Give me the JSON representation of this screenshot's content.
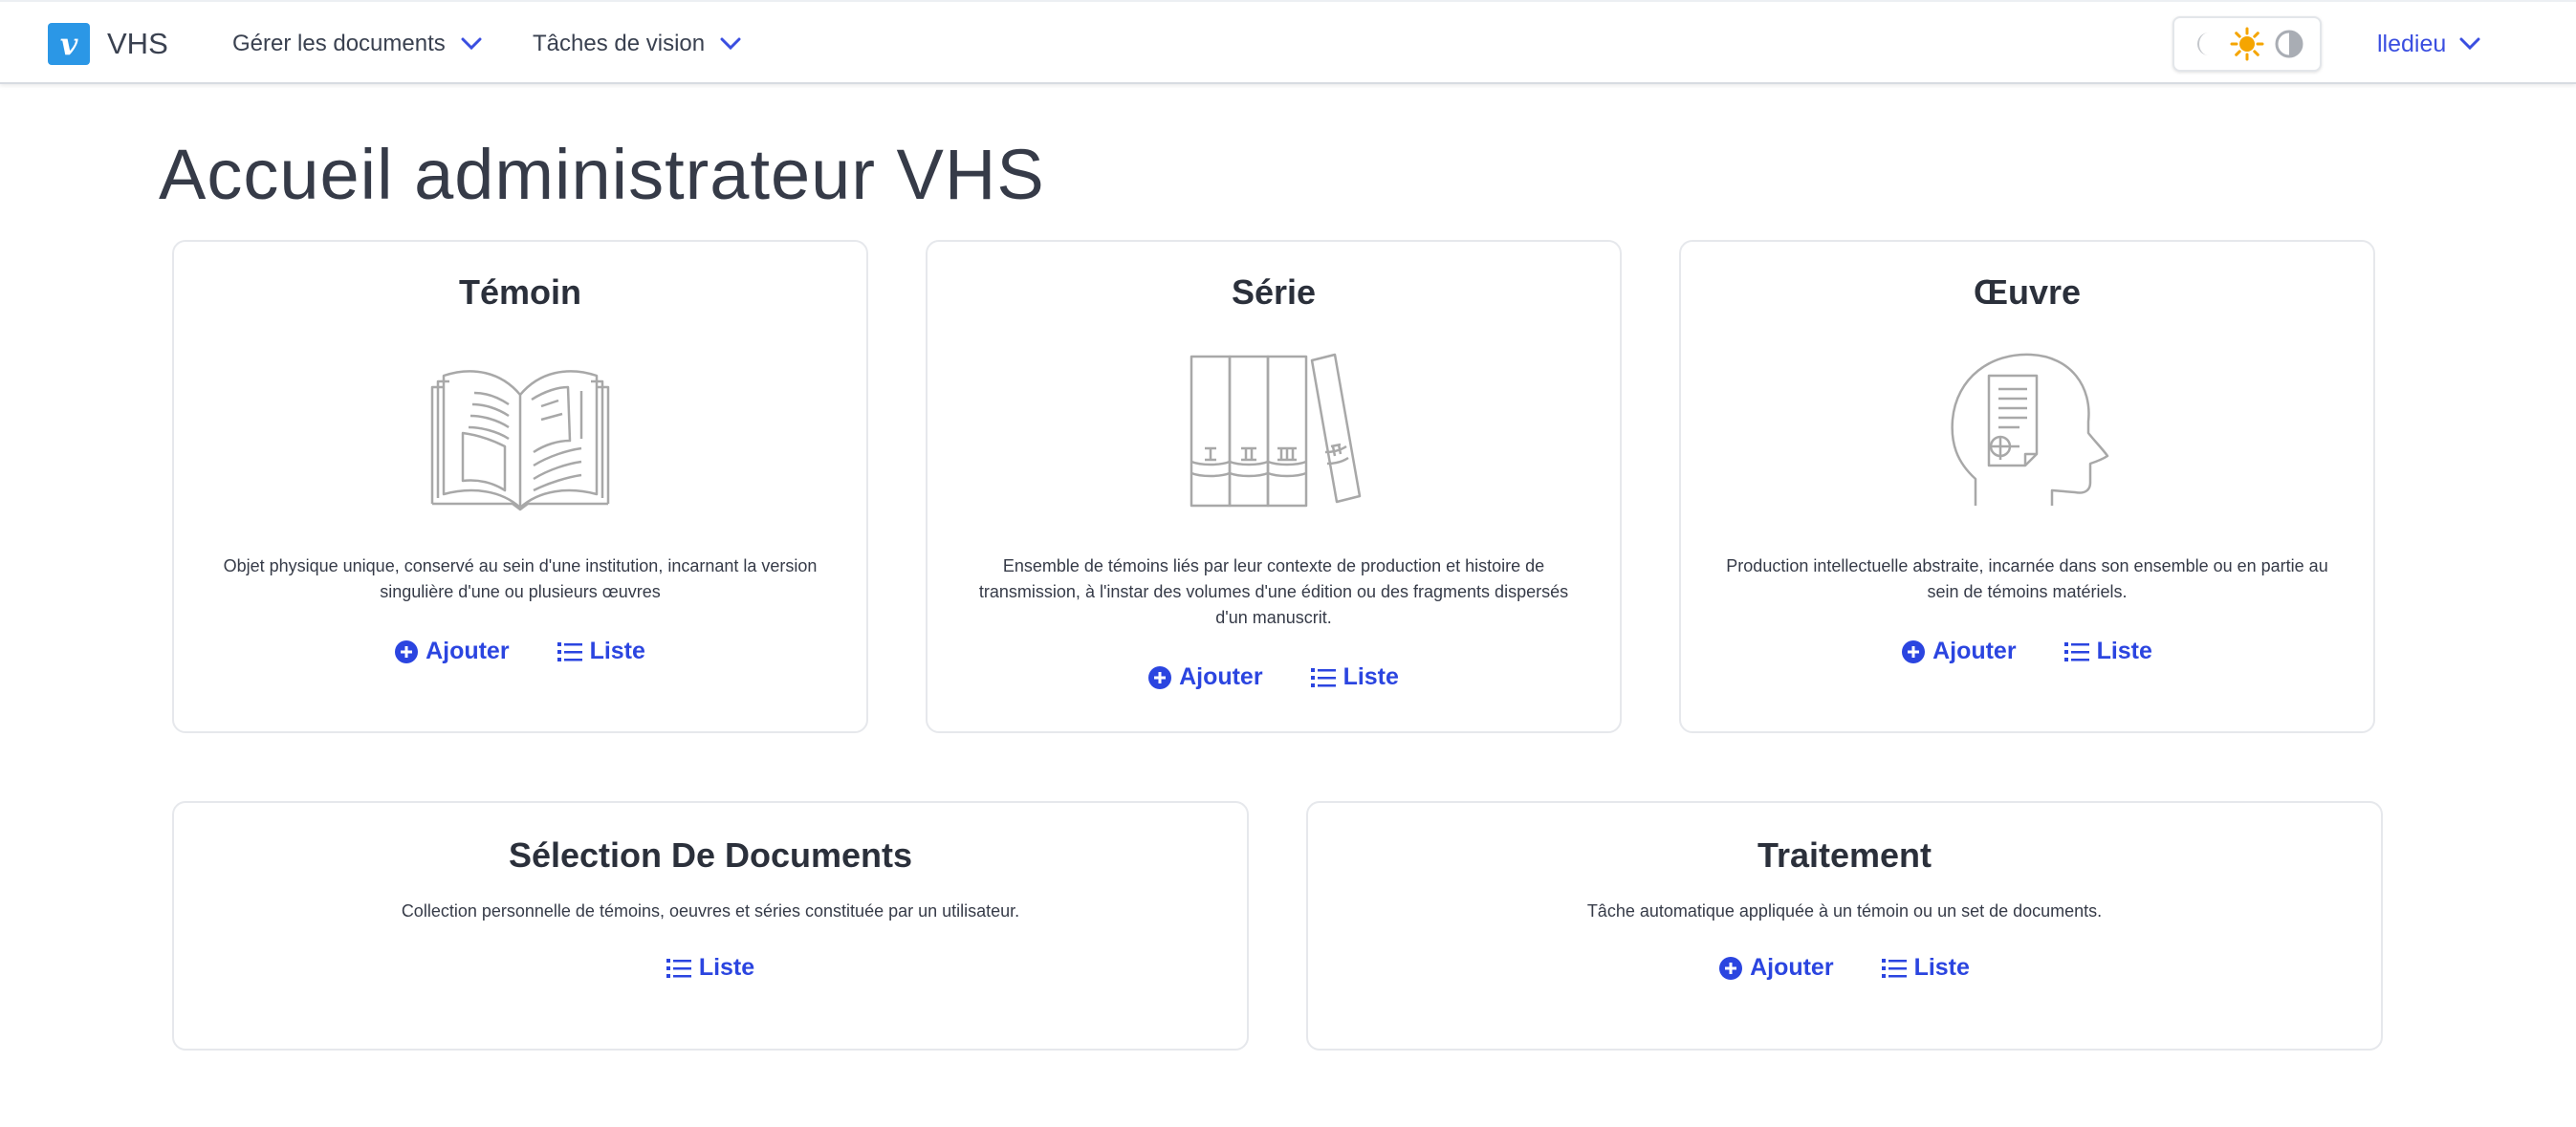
{
  "brand": {
    "logo_letter": "v",
    "name": "VHS",
    "color": "#2b97e6"
  },
  "nav": {
    "items": [
      {
        "label": "Gérer les documents"
      },
      {
        "label": "Tâches de vision"
      }
    ],
    "user": "lledieu",
    "theme_icons": [
      "moon-icon",
      "sun-icon",
      "contrast-icon"
    ]
  },
  "page": {
    "title": "Accueil administrateur VHS"
  },
  "cards": [
    {
      "title": "Témoin",
      "icon": "open-book-icon",
      "description_lines": [
        "Objet physique unique, conservé au sein d'une institution, incarnant la version",
        "singulière d'une ou plusieurs œuvres"
      ],
      "add_label": "Ajouter",
      "list_label": "Liste"
    },
    {
      "title": "Série",
      "icon": "volumes-icon",
      "description_lines": [
        "Ensemble de témoins liés par leur contexte de production et histoire de",
        "transmission, à l'instar des volumes d'une édition ou des fragments dispersés",
        "d'un manuscrit."
      ],
      "add_label": "Ajouter",
      "list_label": "Liste"
    },
    {
      "title": "Œuvre",
      "icon": "head-document-icon",
      "description_lines": [
        "Production intellectuelle abstraite, incarnée dans son ensemble ou en partie au",
        "sein de témoins matériels."
      ],
      "add_label": "Ajouter",
      "list_label": "Liste"
    },
    {
      "title": "Sélection De Documents",
      "description_lines": [
        "Collection personnelle de témoins, oeuvres et séries constituée par un utilisateur."
      ],
      "list_label": "Liste"
    },
    {
      "title": "Traitement",
      "description_lines": [
        "Tâche automatique appliquée à un témoin ou un set de documents."
      ],
      "add_label": "Ajouter",
      "list_label": "Liste"
    }
  ],
  "colors": {
    "accent": "#2b45e0",
    "sun": "#f5a500",
    "text": "#363b48"
  }
}
